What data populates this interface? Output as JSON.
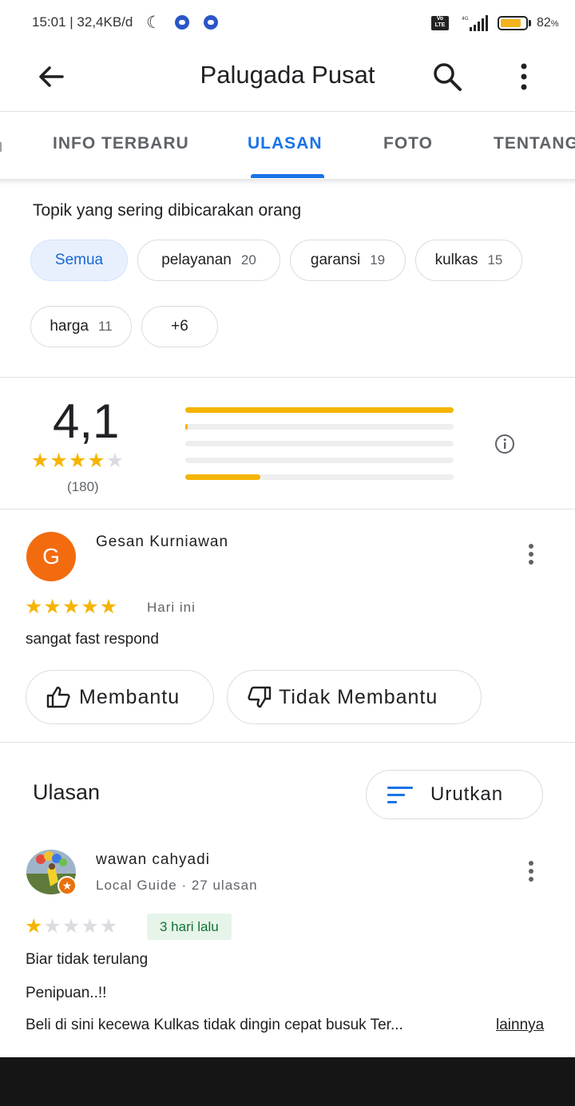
{
  "status_bar": {
    "time_speed": "15:01 | 32,4KB/d",
    "volte": "Vo LTE",
    "battery": "82",
    "battery_level": 0.82
  },
  "header": {
    "title": "Palugada Pusat",
    "back_icon": "arrow-back-icon",
    "search_icon": "search-icon",
    "more_icon": "more-vert-icon"
  },
  "tabs": [
    {
      "label": "INFO TERBARU",
      "active": false
    },
    {
      "label": "ULASAN",
      "active": true
    },
    {
      "label": "FOTO",
      "active": false
    },
    {
      "label": "TENTANG",
      "active": false
    }
  ],
  "topics": {
    "title": "Topik yang sering dibicarakan orang",
    "chips": [
      {
        "label": "Semua",
        "count": "",
        "selected": true
      },
      {
        "label": "pelayanan",
        "count": "20",
        "selected": false
      },
      {
        "label": "garansi",
        "count": "19",
        "selected": false
      },
      {
        "label": "kulkas",
        "count": "15",
        "selected": false
      },
      {
        "label": "harga",
        "count": "11",
        "selected": false
      },
      {
        "label": "+6",
        "count": "",
        "selected": false
      }
    ]
  },
  "rating_summary": {
    "average": "4,1",
    "stars_filled": 4,
    "count": "(180)",
    "distribution_fraction": [
      {
        "stars": 5,
        "fraction": 1.0
      },
      {
        "stars": 4,
        "fraction": 0.01
      },
      {
        "stars": 3,
        "fraction": 0.0
      },
      {
        "stars": 2,
        "fraction": 0.0
      },
      {
        "stars": 1,
        "fraction": 0.28
      }
    ]
  },
  "highlight_review": {
    "avatar_letter": "G",
    "name": "Gesan Kurniawan",
    "stars": 5,
    "time": "Hari ini",
    "text": "sangat fast respond",
    "helpful_label": "Membantu",
    "not_helpful_label": "Tidak Membantu"
  },
  "reviews_section": {
    "title": "Ulasan",
    "sort_label": "Urutkan",
    "sort_icon": "sort-icon"
  },
  "reviews": [
    {
      "name": "wawan cahyadi",
      "meta": "Local Guide · 27 ulasan",
      "stars": 1,
      "time": "3 hari lalu",
      "lines": [
        "Biar tidak terulang",
        "Penipuan..!!",
        "Beli di sini kecewa Kulkas tidak dingin cepat busuk Ter..."
      ],
      "more_label": "lainnya"
    }
  ],
  "colors": {
    "accent": "#1a73e8",
    "star": "#f5b400",
    "avatar_g": "#f26b0f",
    "time_pill_bg": "#e6f4ea",
    "time_pill_text": "#137333"
  }
}
